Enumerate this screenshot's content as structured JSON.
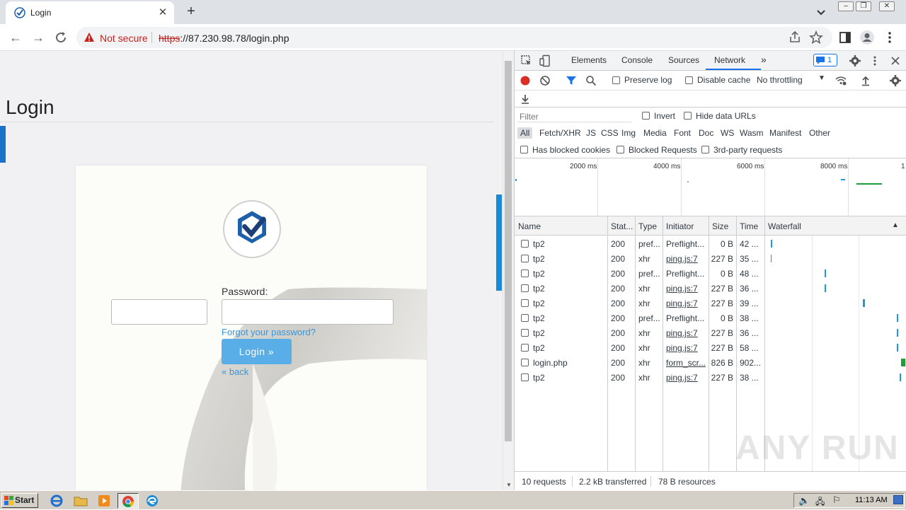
{
  "browser": {
    "tab_title": "Login",
    "tab_close": "✕",
    "new_tab": "+",
    "security_label": "Not secure",
    "url_scheme": "https",
    "url_rest": "://87.230.98.78/login.php"
  },
  "page": {
    "heading": "Login",
    "password_label": "Password:",
    "forgot_link": "Forgot your password?",
    "login_button": "Login »",
    "back_link": "« back"
  },
  "devtools": {
    "tabs": [
      "Elements",
      "Console",
      "Sources",
      "Network"
    ],
    "active_tab": "Network",
    "more_tabs": "»",
    "issues_count": "1",
    "preserve_log": "Preserve log",
    "disable_cache": "Disable cache",
    "throttling": "No throttling",
    "filter_placeholder": "Filter",
    "invert": "Invert",
    "hide_data_urls": "Hide data URLs",
    "type_filters": [
      "All",
      "Fetch/XHR",
      "JS",
      "CSS",
      "Img",
      "Media",
      "Font",
      "Doc",
      "WS",
      "Wasm",
      "Manifest",
      "Other"
    ],
    "has_blocked_cookies": "Has blocked cookies",
    "blocked_requests": "Blocked Requests",
    "third_party": "3rd-party requests",
    "overview_ticks": [
      "2000 ms",
      "4000 ms",
      "6000 ms",
      "8000 ms",
      "1"
    ],
    "columns": [
      "Name",
      "Stat...",
      "Type",
      "Initiator",
      "Size",
      "Time",
      "Waterfall"
    ],
    "rows": [
      {
        "name": "tp2",
        "status": "200",
        "type": "pref...",
        "initiator": "Preflight...",
        "initiator_link": false,
        "size": "0 B",
        "time": "42 ..."
      },
      {
        "name": "tp2",
        "status": "200",
        "type": "xhr",
        "initiator": "ping.js:7",
        "initiator_link": true,
        "size": "227 B",
        "time": "35 ..."
      },
      {
        "name": "tp2",
        "status": "200",
        "type": "pref...",
        "initiator": "Preflight...",
        "initiator_link": false,
        "size": "0 B",
        "time": "48 ..."
      },
      {
        "name": "tp2",
        "status": "200",
        "type": "xhr",
        "initiator": "ping.js:7",
        "initiator_link": true,
        "size": "227 B",
        "time": "36 ..."
      },
      {
        "name": "tp2",
        "status": "200",
        "type": "xhr",
        "initiator": "ping.js:7",
        "initiator_link": true,
        "size": "227 B",
        "time": "39 ..."
      },
      {
        "name": "tp2",
        "status": "200",
        "type": "pref...",
        "initiator": "Preflight...",
        "initiator_link": false,
        "size": "0 B",
        "time": "38 ..."
      },
      {
        "name": "tp2",
        "status": "200",
        "type": "xhr",
        "initiator": "ping.js:7",
        "initiator_link": true,
        "size": "227 B",
        "time": "36 ..."
      },
      {
        "name": "tp2",
        "status": "200",
        "type": "xhr",
        "initiator": "ping.js:7",
        "initiator_link": true,
        "size": "227 B",
        "time": "58 ..."
      },
      {
        "name": "login.php",
        "status": "200",
        "type": "xhr",
        "initiator": "form_scr...",
        "initiator_link": true,
        "size": "826 B",
        "time": "902..."
      },
      {
        "name": "tp2",
        "status": "200",
        "type": "xhr",
        "initiator": "ping.js:7",
        "initiator_link": true,
        "size": "227 B",
        "time": "38 ..."
      }
    ],
    "status_requests": "10 requests",
    "status_transferred": "2.2 kB transferred",
    "status_resources": "78 B resources",
    "watermark": "ANY RUN"
  },
  "taskbar": {
    "start_label": "Start",
    "clock": "11:13 AM"
  },
  "colors": {
    "accent_blue": "#1a73e8",
    "record_red": "#d93025",
    "login_button": "#5aaee8",
    "link_blue": "#3b96d8"
  }
}
